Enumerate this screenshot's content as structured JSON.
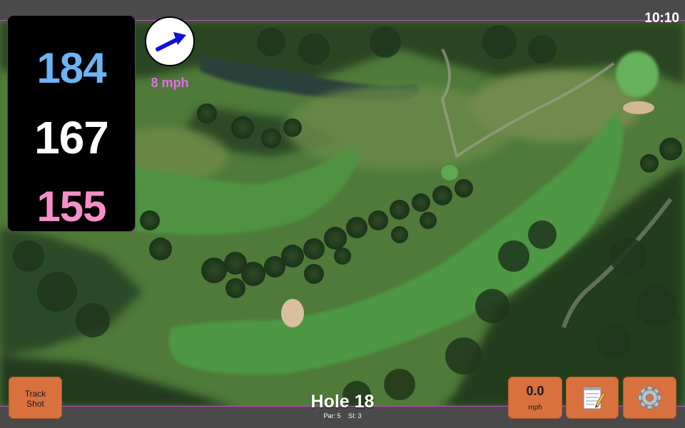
{
  "status_bar": {
    "time": "10:10"
  },
  "distances": {
    "back": "184",
    "middle": "167",
    "front": "155"
  },
  "wind": {
    "speed": "8 mph",
    "direction_icon": "arrow-right-icon",
    "color": "#e070e0"
  },
  "track_button": {
    "line1": "Track",
    "line2": "Shot"
  },
  "speed_button": {
    "value": "0.0",
    "unit": "mph"
  },
  "notes_button": {
    "icon": "notepad-icon"
  },
  "settings_button": {
    "icon": "gear-icon"
  },
  "hole": {
    "title": "Hole 18",
    "par": "Par: 5",
    "si": "SI: 3"
  },
  "colors": {
    "back_distance": "#6cb4f5",
    "middle_distance": "#ffffff",
    "front_distance": "#f58fc8",
    "button": "#d9713f",
    "bars": "#4a4a4a"
  }
}
